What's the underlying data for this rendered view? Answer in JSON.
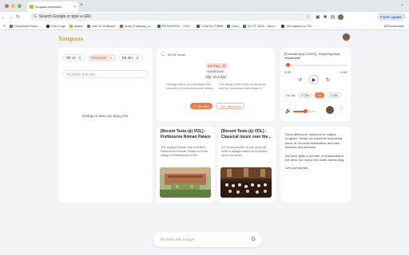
{
  "browser": {
    "tab_title": "Youpass extension",
    "omnibox_placeholder": "Search Google or type a URL",
    "update_label": "Finish update",
    "bookmarks": [
      {
        "label": "Dropdown Menu -...",
        "color": "#c44"
      },
      {
        "label": "Ehrc bugs",
        "color": "#333"
      },
      {
        "label": "assba",
        "color": "#e8a23a"
      },
      {
        "label": "Joel on Software",
        "color": "#777"
      },
      {
        "label": "Nomi_Features_Li...",
        "color": "#d4452a"
      },
      {
        "label": "RESOURCE - YOU...",
        "color": "#1a7a3e"
      },
      {
        "label": "COM IELTSBM",
        "color": "#2a5ab0"
      },
      {
        "label": "Docs",
        "color": "#2a6ae0"
      },
      {
        "label": "IELTS 1604 - Nên l...",
        "color": "#2a6ae0"
      },
      {
        "label": "Get started on TA...",
        "color": "#444"
      }
    ],
    "all_bookmarks": "All Bookmarks"
  },
  "app": {
    "logo": "Youpass"
  },
  "left_panel": {
    "filters": [
      {
        "label": "Tất cả",
        "count": "0",
        "active": false
      },
      {
        "label": "Chưa làm",
        "count": "0",
        "active": true
      },
      {
        "label": "Đã làm",
        "count": "0",
        "active": false
      }
    ],
    "search_placeholder": "Tìm kiếm tình nền...",
    "empty_text": "Không có task nào đang chờ"
  },
  "word_card": {
    "chip": "Bổ sở vocab",
    "highlight": "geology",
    "word": "word/noun",
    "ipa": "/dʒi ˈɒl.ə.dʒi/",
    "def_left": "Geology helps us understand the formation of mountains and valleys.",
    "def_right": "The study of the Earth, its structure and the processes that shape it.",
    "save_label": "Đã thêm",
    "more_label": "Tìm hiểu thêm"
  },
  "articles": [
    {
      "title": "[Recent Tests-(ẹ̀) VOL] - Fishbourne Roman Palace",
      "desc": "The largest Roman villa in Britain Fishbourne Roman Palace is in the village of Fishbourne in We..."
    },
    {
      "title": "[Recent Tests-(ẹ̀) VOL] - Classical music over the...",
      "desc": "A [The production of any good art work is always based on inception, done not usual..."
    }
  ],
  "player": {
    "title": "[Forecast Quý 2-2023] - Exploring local restaurants",
    "progress": 0.02,
    "time_current": "0:00",
    "time_total": "5:46",
    "speed_label": "Tốc độ:",
    "speeds": [
      {
        "label": "0.75x",
        "on": false
      },
      {
        "label": "1x",
        "on": true
      },
      {
        "label": "1.25x",
        "on": false
      }
    ],
    "volume": 0.55
  },
  "transcript": [
    "Good afternoon, welcome to today's program. Today, we would be examining some of our local restaurants and their features and services.",
    "We have quite a number of restaurants in the area, but only a few worth mentioning.",
    "Let's get started."
  ],
  "google_search": {
    "placeholder": "Tìm kiếm trên Google",
    "logo": "G"
  }
}
